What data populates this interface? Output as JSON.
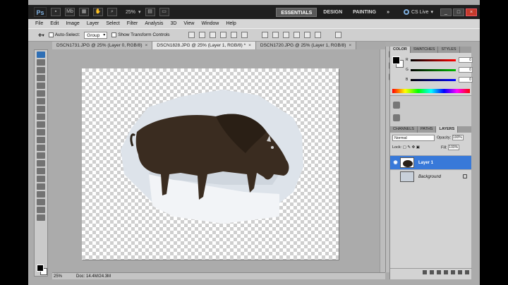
{
  "app": {
    "logo": "Ps",
    "zoom": "25%",
    "workspaces": [
      "ESSENTIALS",
      "DESIGN",
      "PAINTING"
    ],
    "more": "»",
    "cslive": "CS Live",
    "cslive_caret": "▾",
    "icon_mb": "Mb",
    "win_min": "_",
    "win_max": "□",
    "win_close": "×"
  },
  "menu": [
    "File",
    "Edit",
    "Image",
    "Layer",
    "Select",
    "Filter",
    "Analysis",
    "3D",
    "View",
    "Window",
    "Help"
  ],
  "options": {
    "auto_select_label": "Auto-Select:",
    "auto_select_value": "Group",
    "transform_label": "Show Transform Controls"
  },
  "tabs": [
    {
      "label": "DSCN1731.JPG @ 25% (Layer 0, RGB/8)",
      "close": "×"
    },
    {
      "label": "DSCN1828.JPG @ 25% (Layer 1, RGB/8) *",
      "close": "×"
    },
    {
      "label": "DSCN1720.JPG @ 25% (Layer 1, RGB/8)",
      "close": "×"
    }
  ],
  "status": {
    "zoom": "25%",
    "doc": "Doc: 14.4M/24.3M"
  },
  "color_panel": {
    "tabs": [
      "COLOR",
      "SWATCHES",
      "STYLES"
    ],
    "r_label": "R",
    "g_label": "G",
    "b_label": "B",
    "r": "0",
    "g": "0",
    "b": "0"
  },
  "layers_panel": {
    "tabs": [
      "CHANNELS",
      "PATHS",
      "LAYERS"
    ],
    "blend_mode": "Normal",
    "opacity_label": "Opacity:",
    "opacity": "100%",
    "lock_label": "Lock:",
    "fill_label": "Fill:",
    "fill": "100%",
    "layers": [
      {
        "name": "Layer 1",
        "selected": true
      },
      {
        "name": "Background",
        "selected": false
      }
    ]
  },
  "colors": {
    "selection": "#3879d9",
    "app_bar": "#1f1f1f",
    "canvas_bg": "#ababab"
  }
}
